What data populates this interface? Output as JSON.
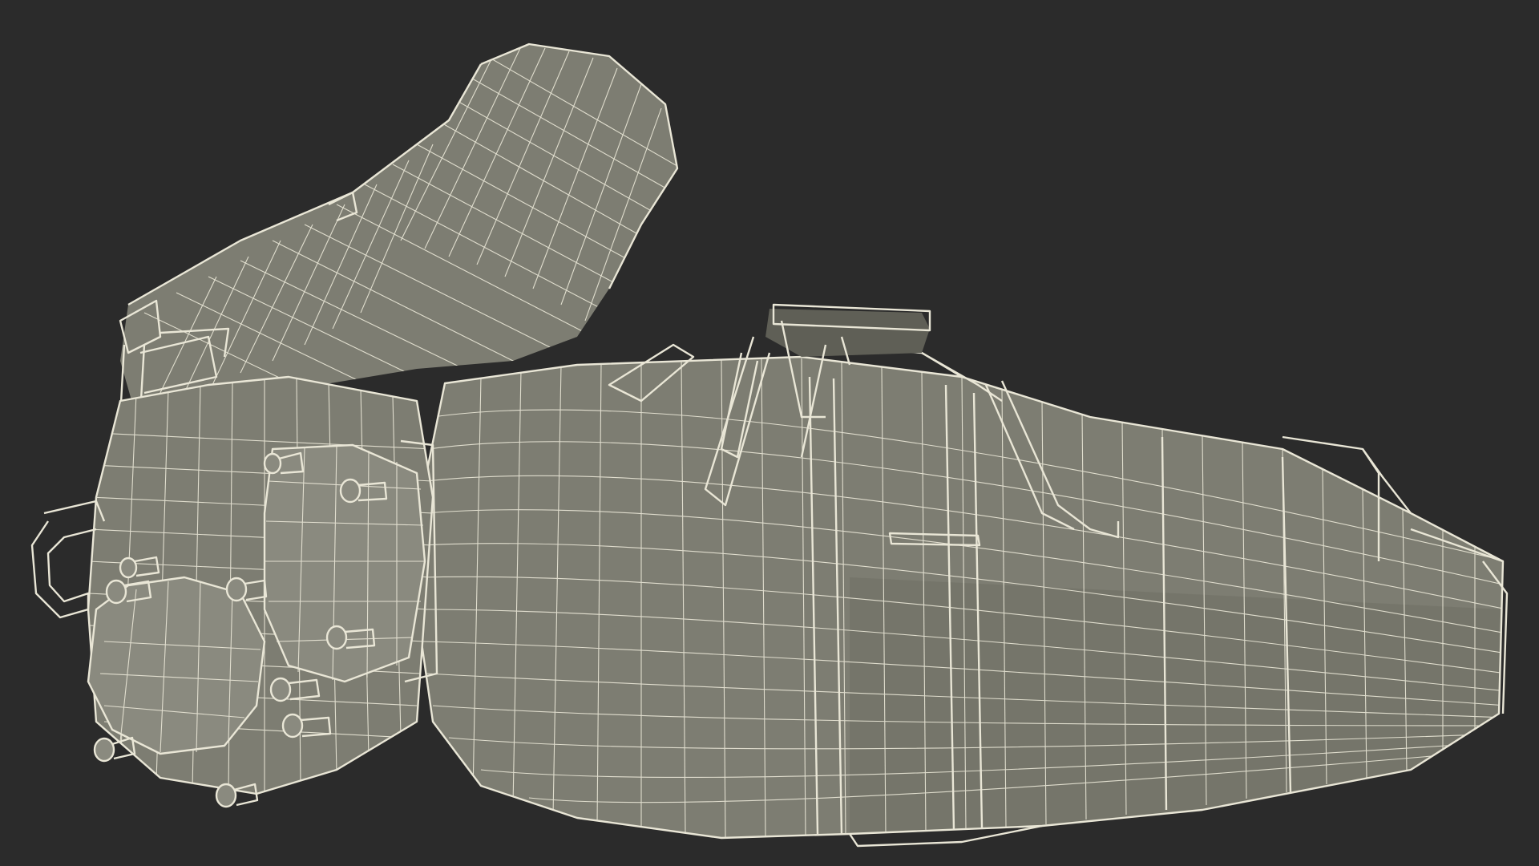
{
  "scene": {
    "background_color": "#2b2b2b",
    "mesh_fill_color": "#7d7d72",
    "wire_color": "#e9e6d6"
  }
}
